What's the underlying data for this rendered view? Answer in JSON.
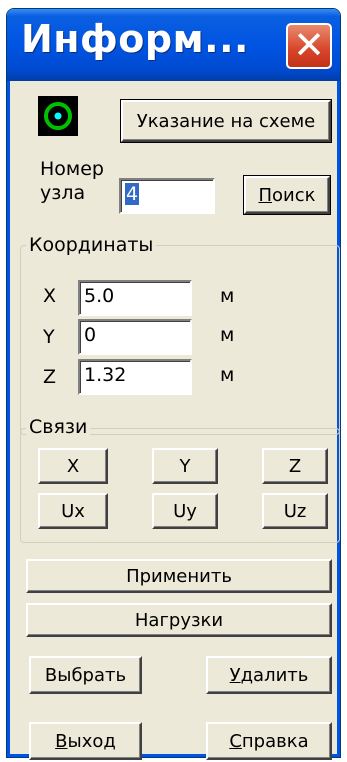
{
  "window": {
    "title": "Информ...",
    "close_glyph": "✕"
  },
  "node": {
    "locate_button": "Указание на схеме",
    "label_line1": "Номер",
    "label_line2": "узла",
    "number_value": "4",
    "search_button_accel": "П",
    "search_button_rest": "оиск",
    "icon": "node-circle-icon"
  },
  "coords": {
    "legend": "Координаты",
    "rows": [
      {
        "axis": "X",
        "value": "5.0",
        "unit": "м"
      },
      {
        "axis": "Y",
        "value": "0",
        "unit": "м"
      },
      {
        "axis": "Z",
        "value": "1.32",
        "unit": "м"
      }
    ]
  },
  "links": {
    "legend": "Связи",
    "buttons": [
      "X",
      "Y",
      "Z",
      "Ux",
      "Uy",
      "Uz"
    ]
  },
  "actions": {
    "apply": "Применить",
    "loads": "Нагрузки",
    "select": "Выбрать",
    "delete_accel": "У",
    "delete_rest": "далить",
    "exit_accel": "В",
    "exit_rest": "ыход",
    "help_accel": "С",
    "help_rest": "правка"
  },
  "colors": {
    "titlebar": "#0054e3",
    "close": "#d7442a",
    "dialog_bg": "#ece9d8",
    "icon_ring": "#00c000",
    "icon_dot": "#00ffff"
  }
}
